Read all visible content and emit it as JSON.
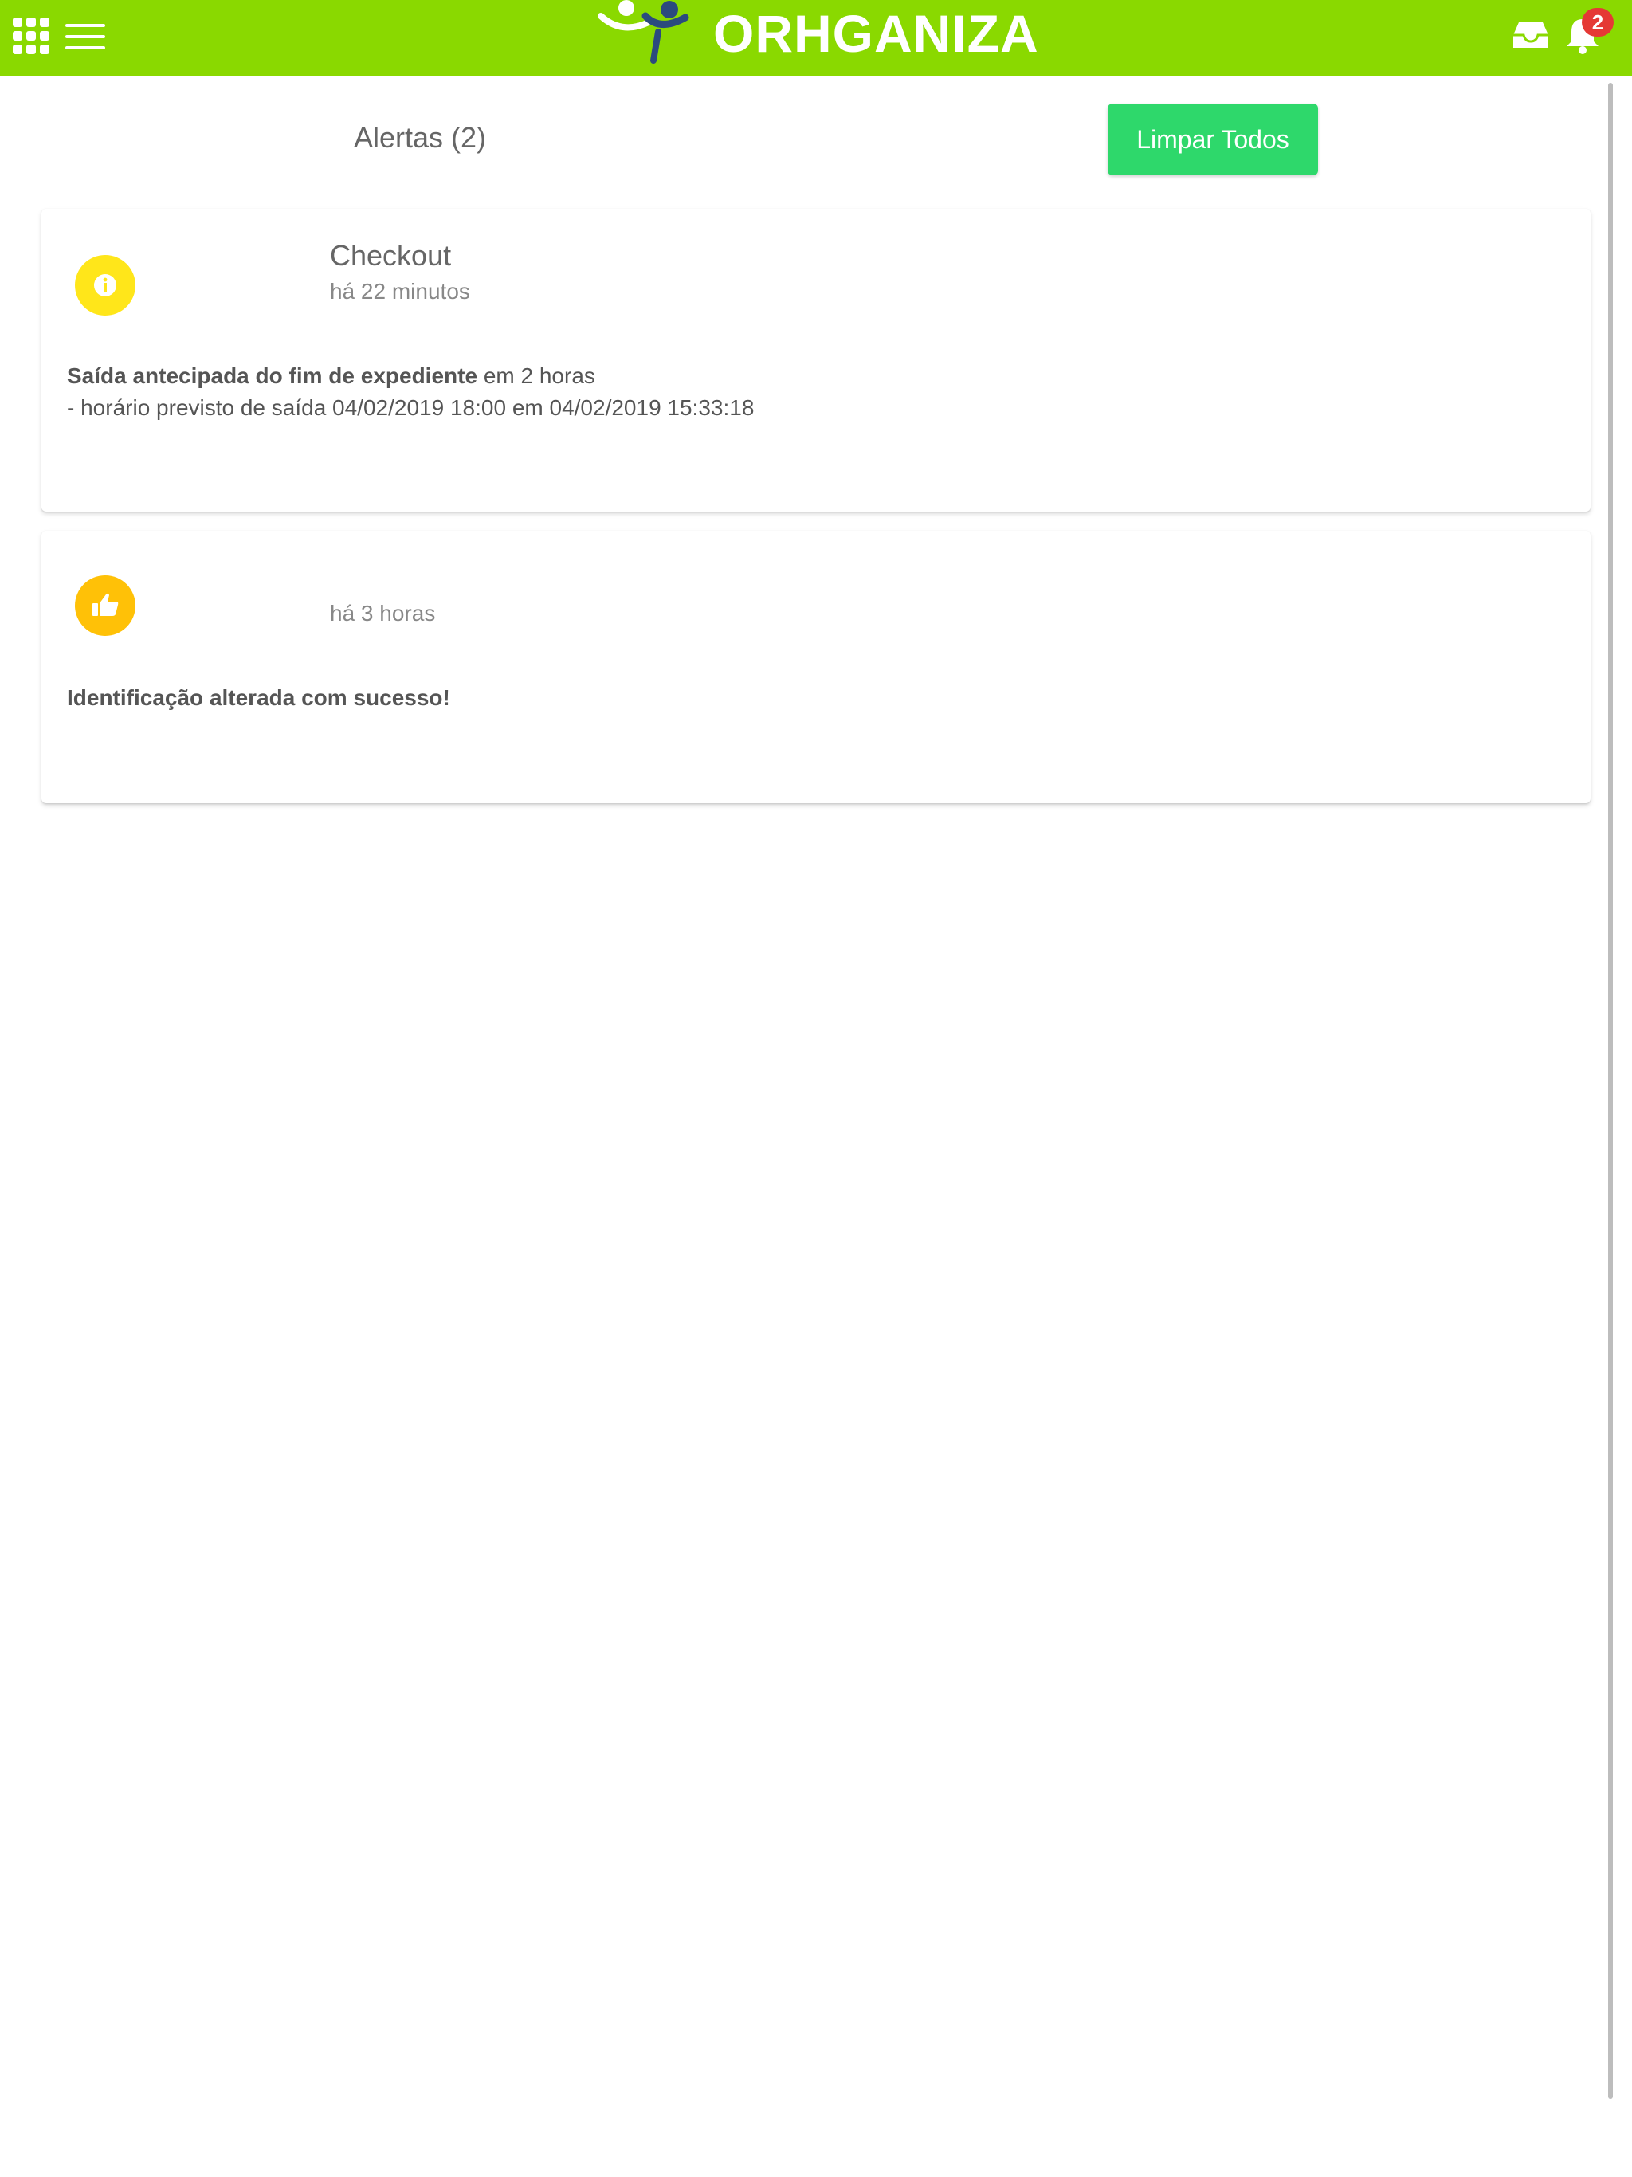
{
  "header": {
    "brand": "ORHGANIZA",
    "notification_count": "2",
    "colors": {
      "bar": "#8ad900",
      "badge": "#e53935"
    },
    "icons": [
      "apps-grid-icon",
      "menu-icon",
      "inbox-icon",
      "bell-icon"
    ]
  },
  "alerts": {
    "title": "Alertas (2)",
    "clear_label": "Limpar Todos",
    "clear_color": "#2ed86b"
  },
  "cards": [
    {
      "icon": "info-icon",
      "icon_color": "#ffe61a",
      "title": "Checkout",
      "time": "há 22 minutos",
      "body_bold": "Saída antecipada do fim de expediente",
      "body_rest": " em 2 horas",
      "body_line2": "- horário previsto de saída 04/02/2019 18:00 em 04/02/2019 15:33:18"
    },
    {
      "icon": "thumbs-up-icon",
      "icon_color": "#ffc107",
      "title": "",
      "time": "há 3 horas",
      "body_bold": "Identificação alterada com sucesso!"
    }
  ]
}
